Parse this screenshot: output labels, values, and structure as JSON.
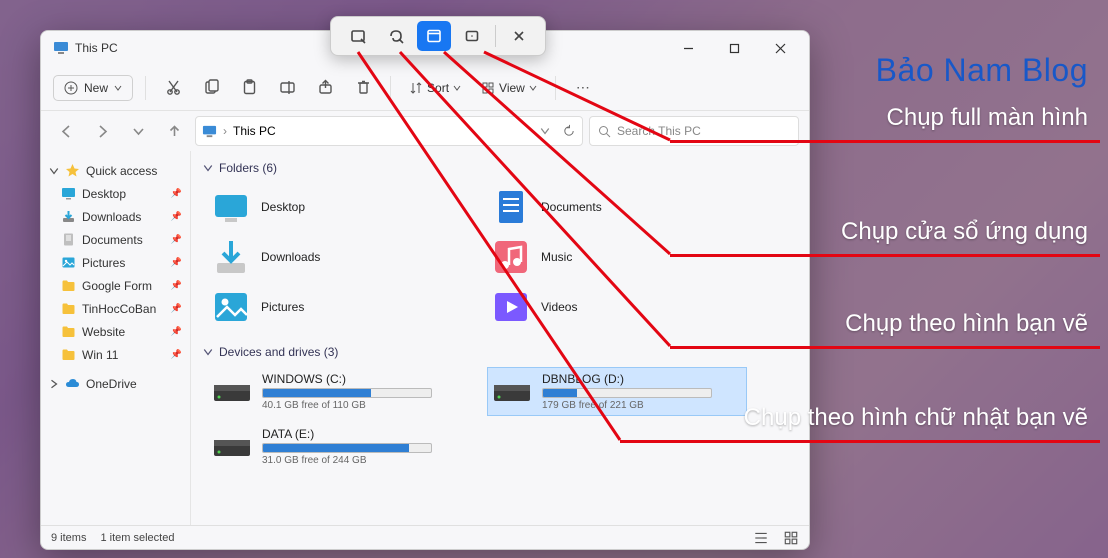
{
  "window": {
    "title": "This PC",
    "ribbon": {
      "new_label": "New",
      "sort_label": "Sort",
      "view_label": "View"
    },
    "address": {
      "location": "This PC"
    },
    "search": {
      "placeholder": "Search This PC"
    }
  },
  "sidebar": {
    "quick_access": "Quick access",
    "items": [
      {
        "label": "Desktop",
        "pinned": true
      },
      {
        "label": "Downloads",
        "pinned": true
      },
      {
        "label": "Documents",
        "pinned": true
      },
      {
        "label": "Pictures",
        "pinned": true
      },
      {
        "label": "Google Form",
        "pinned": true
      },
      {
        "label": "TinHocCoBan",
        "pinned": true
      },
      {
        "label": "Website",
        "pinned": true
      },
      {
        "label": "Win 11",
        "pinned": true
      }
    ],
    "onedrive": "OneDrive"
  },
  "content": {
    "folders_header": "Folders (6)",
    "folders": [
      {
        "name": "Desktop",
        "color": "#2aa6d8"
      },
      {
        "name": "Documents",
        "color": "#2a7bd8"
      },
      {
        "name": "Downloads",
        "color": "#2aa6d8"
      },
      {
        "name": "Music",
        "color": "#f0677a"
      },
      {
        "name": "Pictures",
        "color": "#2aa6d8"
      },
      {
        "name": "Videos",
        "color": "#7b59ff"
      }
    ],
    "drives_header": "Devices and drives (3)",
    "drives": [
      {
        "name": "WINDOWS (C:)",
        "free_text": "40.1 GB free of 110 GB",
        "fill_pct": 64,
        "selected": false
      },
      {
        "name": "DBNBLOG (D:)",
        "free_text": "179 GB free of 221 GB",
        "fill_pct": 20,
        "selected": true
      },
      {
        "name": "DATA (E:)",
        "free_text": "31.0 GB free of 244 GB",
        "fill_pct": 87,
        "selected": false
      }
    ]
  },
  "statusbar": {
    "items": "9 items",
    "selected": "1 item selected"
  },
  "snipbar": {
    "modes": [
      {
        "id": "rectangle",
        "active": false
      },
      {
        "id": "freeform",
        "active": false
      },
      {
        "id": "window",
        "active": true
      },
      {
        "id": "fullscreen",
        "active": false
      }
    ]
  },
  "annotations": {
    "brand": "Bảo Nam Blog",
    "labels": [
      "Chụp full màn hình",
      "Chụp cửa sổ ứng dụng",
      "Chụp theo hình bạn vẽ",
      "Chụp theo hình chữ nhật bạn vẽ"
    ]
  },
  "colors": {
    "accent": "#1877f2",
    "annotation_red": "#e30613",
    "brand_blue": "#1858c8"
  }
}
